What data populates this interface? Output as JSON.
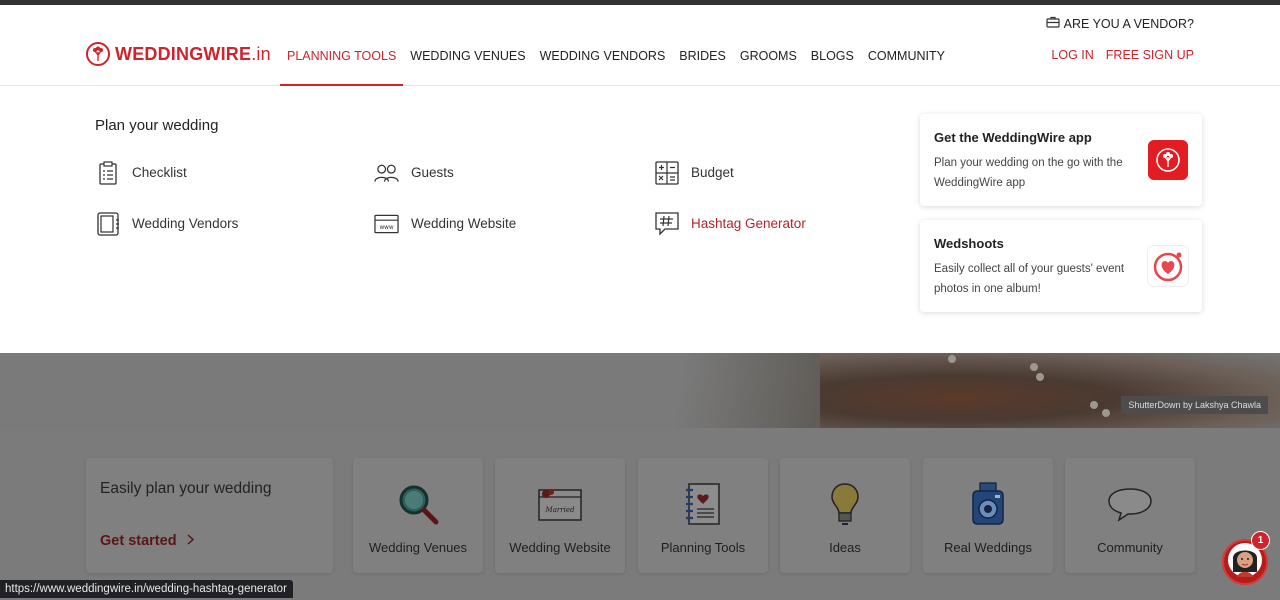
{
  "header": {
    "logo": {
      "brand": "WEDDINGWIRE",
      "tld": ".in"
    },
    "nav": [
      {
        "label": "PLANNING TOOLS",
        "active": true
      },
      {
        "label": "WEDDING VENUES"
      },
      {
        "label": "WEDDING VENDORS"
      },
      {
        "label": "BRIDES"
      },
      {
        "label": "GROOMS"
      },
      {
        "label": "BLOGS"
      },
      {
        "label": "COMMUNITY"
      }
    ],
    "vendor_link": "ARE YOU A VENDOR?",
    "login": "LOG IN",
    "signup": "FREE SIGN UP"
  },
  "dropdown": {
    "title": "Plan your wedding",
    "tools": [
      {
        "label": "Checklist",
        "icon": "checklist-icon"
      },
      {
        "label": "Guests",
        "icon": "guests-icon"
      },
      {
        "label": "Budget",
        "icon": "budget-icon"
      },
      {
        "label": "Wedding Vendors",
        "icon": "vendors-icon"
      },
      {
        "label": "Wedding Website",
        "icon": "website-icon"
      },
      {
        "label": "Hashtag Generator",
        "icon": "hashtag-icon",
        "hovered": true
      }
    ],
    "promos": [
      {
        "title": "Get the WeddingWire app",
        "text": "Plan your wedding on the go with the WeddingWire app",
        "icon": "app-icon"
      },
      {
        "title": "Wedshoots",
        "text": "Easily collect all of your guests' event photos in one album!",
        "icon": "wedshoots-icon"
      }
    ]
  },
  "hero": {
    "credit": "ShutterDown by Lakshya Chawla"
  },
  "plan_section": {
    "title": "Easily plan your wedding",
    "cta": "Get started",
    "tiles": [
      {
        "label": "Wedding Venues",
        "icon": "magnifier-icon"
      },
      {
        "label": "Wedding Website",
        "icon": "invitation-icon"
      },
      {
        "label": "Planning Tools",
        "icon": "notebook-icon"
      },
      {
        "label": "Ideas",
        "icon": "lightbulb-icon"
      },
      {
        "label": "Real Weddings",
        "icon": "camera-icon"
      },
      {
        "label": "Community",
        "icon": "speech-bubble-icon"
      }
    ]
  },
  "status_bar": {
    "url": "https://www.weddingwire.in/wedding-hashtag-generator"
  },
  "chat": {
    "badge": "1"
  },
  "colors": {
    "brand": "#d0232b",
    "overlay": "#7b7b7b"
  }
}
